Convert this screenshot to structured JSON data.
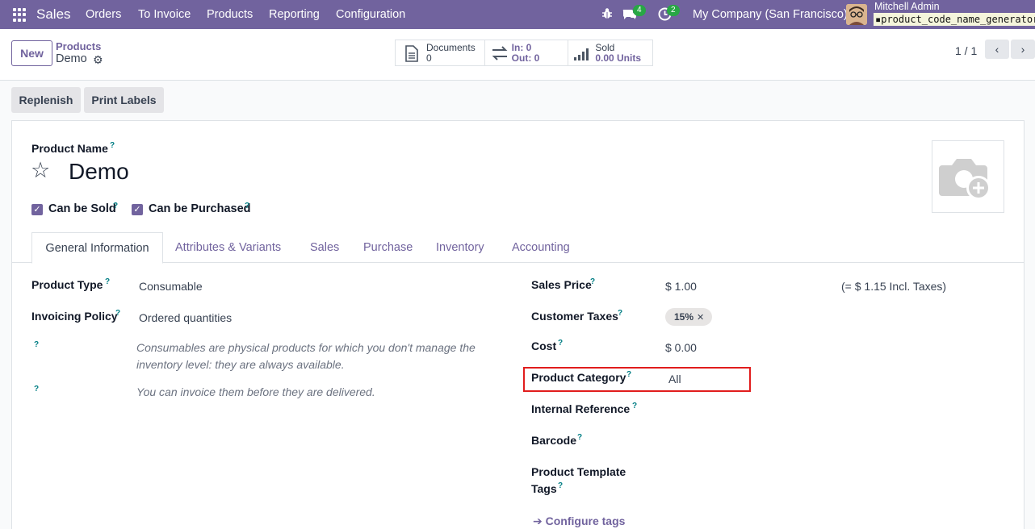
{
  "navbar": {
    "brand": "Sales",
    "menus": [
      "Orders",
      "To Invoice",
      "Products",
      "Reporting",
      "Configuration"
    ],
    "chat_count": "4",
    "activity_count": "2",
    "company": "My Company (San Francisco)",
    "user_name": "Mitchell Admin",
    "database": "product_code_name_generator",
    "accent_color": "#71639e"
  },
  "control": {
    "new_label": "New",
    "breadcrumb_parent": "Products",
    "breadcrumb_current": "Demo",
    "smart_buttons": {
      "documents_label": "Documents",
      "documents_value": "0",
      "in_label": "In: 0",
      "out_label": "Out: 0",
      "sold_label": "Sold",
      "sold_value": "0.00 Units"
    },
    "pager": "1 / 1"
  },
  "actions": {
    "replenish": "Replenish",
    "print_labels": "Print Labels"
  },
  "form": {
    "product_name_label": "Product Name",
    "product_name": "Demo",
    "can_be_sold": "Can be Sold",
    "can_be_purchased": "Can be Purchased",
    "help_mark": "?",
    "tabs": [
      "General Information",
      "Attributes & Variants",
      "Sales",
      "Purchase",
      "Inventory",
      "Accounting"
    ],
    "left": {
      "product_type_label": "Product Type",
      "product_type": "Consumable",
      "invoicing_policy_label": "Invoicing Policy",
      "invoicing_policy": "Ordered quantities",
      "note_consumable_1": "Consumables are physical products for which you don't manage the",
      "note_consumable_2": "inventory level: they are always available.",
      "note_invoice": "You can invoice them before they are delivered."
    },
    "right": {
      "sales_price_label": "Sales Price",
      "sales_price": "$ 1.00",
      "incl_taxes": "(= $ 1.15 Incl. Taxes)",
      "customer_taxes_label": "Customer Taxes",
      "tax_tag": "15%",
      "cost_label": "Cost",
      "cost": "$ 0.00",
      "product_category_label": "Product Category",
      "product_category": "All",
      "internal_reference_label": "Internal Reference",
      "barcode_label": "Barcode",
      "template_tags_label_1": "Product Template",
      "template_tags_label_2": "Tags",
      "configure_tags": "Configure tags"
    }
  }
}
